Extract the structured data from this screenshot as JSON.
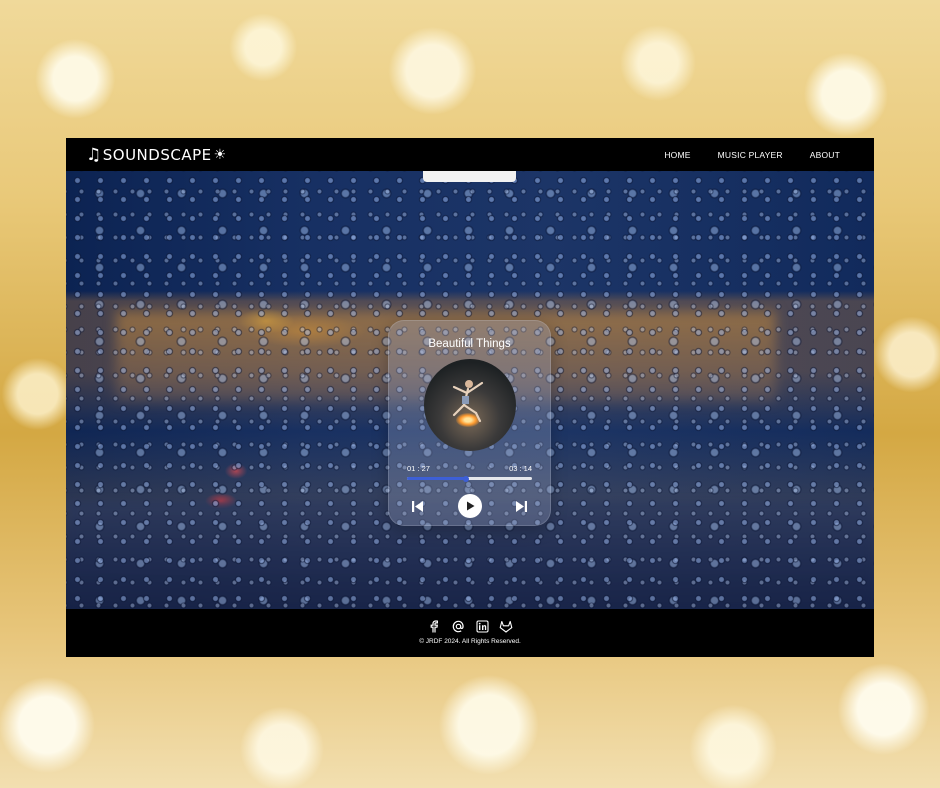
{
  "brand": {
    "name": "SOUNDSCAPE",
    "note_icon": "music-note-icon",
    "sun_icon": "sun-icon"
  },
  "nav": {
    "items": [
      {
        "label": "HOME"
      },
      {
        "label": "MUSIC PLAYER"
      },
      {
        "label": "ABOUT"
      }
    ]
  },
  "player": {
    "title": "Beautiful Things",
    "current_time": "01 : 27",
    "duration": "03 : 14",
    "progress_fraction": 0.47,
    "accent": "#3d5fd6"
  },
  "controls": {
    "prev_icon": "skip-back-icon",
    "play_icon": "play-icon",
    "next_icon": "skip-forward-icon"
  },
  "footer": {
    "social_icons": [
      "facebook-icon",
      "at-sign-icon",
      "linkedin-icon",
      "gitlab-icon"
    ],
    "copyright": "© JRDF 2024. All Rights Reserved."
  }
}
